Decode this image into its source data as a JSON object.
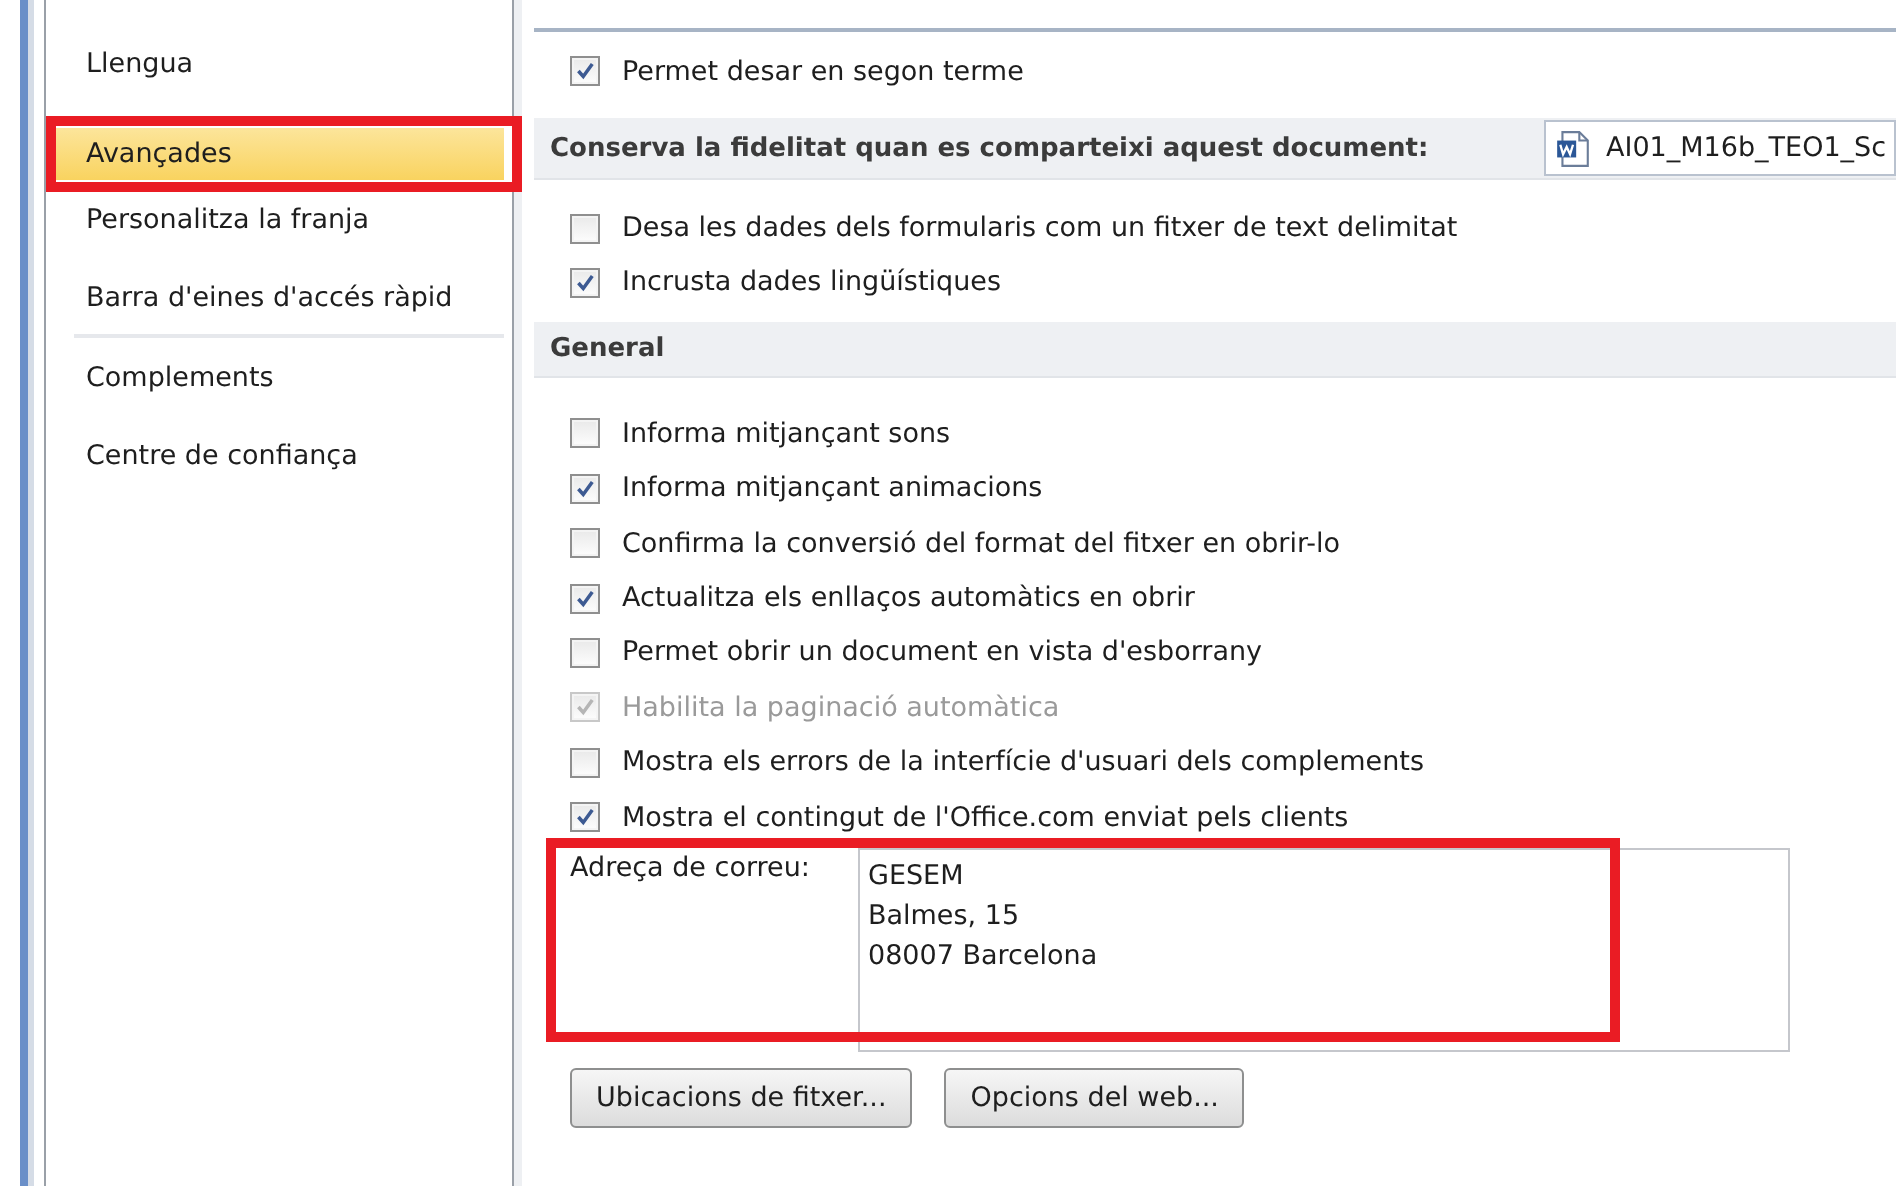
{
  "sidebar": {
    "items": [
      {
        "label": "Llengua",
        "selected": false,
        "marked": false
      },
      {
        "label": "Avançades",
        "selected": true,
        "marked": true
      },
      {
        "label": "Personalitza la franja",
        "selected": false,
        "marked": false
      },
      {
        "label": "Barra d'eines d'accés ràpid",
        "selected": false,
        "marked": false,
        "separator_after": true
      },
      {
        "label": "Complements",
        "selected": false,
        "marked": false
      },
      {
        "label": "Centre de confiança",
        "selected": false,
        "marked": false
      }
    ]
  },
  "options_top": [
    {
      "label": "Permet desar en segon terme",
      "checked": true,
      "disabled": false
    }
  ],
  "fidelity": {
    "label": "Conserva la fidelitat quan es comparteixi aquest document:",
    "document": "AI01_M16b_TEO1_Sc",
    "options": [
      {
        "label": "Desa les dades dels formularis com un fitxer de text delimitat",
        "checked": false,
        "disabled": false
      },
      {
        "label": "Incrusta dades lingüístiques",
        "checked": true,
        "disabled": false
      }
    ]
  },
  "general": {
    "title": "General",
    "options": [
      {
        "label": "Informa mitjançant sons",
        "checked": false,
        "disabled": false
      },
      {
        "label": "Informa mitjançant animacions",
        "checked": true,
        "disabled": false
      },
      {
        "label": "Confirma la conversió del format del fitxer en obrir-lo",
        "checked": false,
        "disabled": false
      },
      {
        "label": "Actualitza els enllaços automàtics en obrir",
        "checked": true,
        "disabled": false
      },
      {
        "label": "Permet obrir un document en vista d'esborrany",
        "checked": false,
        "disabled": false
      },
      {
        "label": "Habilita la paginació automàtica",
        "checked": true,
        "disabled": true
      },
      {
        "label": "Mostra els errors de la interfície d'usuari dels complements",
        "checked": false,
        "disabled": false
      },
      {
        "label": "Mostra el contingut de l'Office.com enviat pels clients",
        "checked": true,
        "disabled": false
      }
    ],
    "address": {
      "label": "Adreça de correu:",
      "value": "GESEM\nBalmes, 15\n08007 Barcelona",
      "marked": true
    },
    "buttons": [
      "Ubicacions de fitxer...",
      "Opcions del web..."
    ]
  }
}
